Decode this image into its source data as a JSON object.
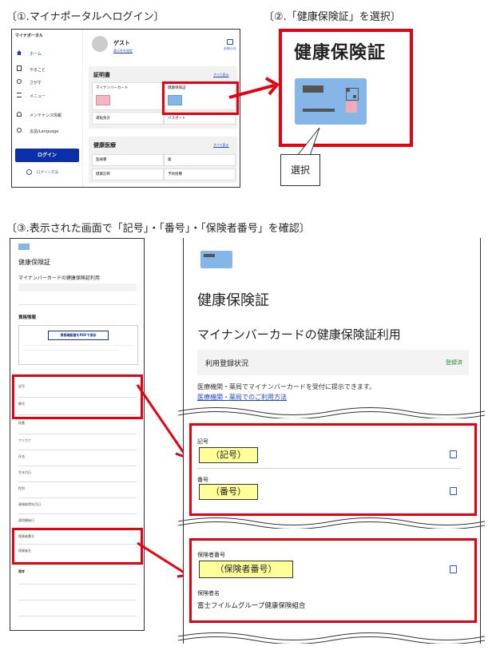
{
  "steps": {
    "step1": "〔①.マイナポータルへログイン〕",
    "step2": "〔②.「健康保険証」を選択〕",
    "step3": "〔③.表示された画面で「記号」・「番号」・「保険者番号」を確認〕"
  },
  "portal": {
    "brand": "マイナポータル",
    "nav": [
      "ホーム",
      "やること",
      "さがす",
      "メニュー",
      "メンテナンス情報",
      "言語/Language"
    ],
    "login_button": "ログイン",
    "login_howto": "ログイン方法",
    "user_name": "ゲスト",
    "user_link": "表示名を設定",
    "notification": "お知らせ",
    "section_certificates": "証明書",
    "section_health": "健康医療",
    "see_all": "すべて見る",
    "certificate_cards": [
      "マイナンバーカード",
      "健康保険証",
      "運転免許",
      "パスポート"
    ],
    "health_cards": [
      "医療費",
      "薬",
      "健康診断",
      "予防接種"
    ]
  },
  "zoom": {
    "title": "健康保険証",
    "callout": "選択"
  },
  "detail": {
    "page_title": "健康保険証",
    "subtitle": "マイナンバーカードの健康保険証利用",
    "registration_label": "利用登録状況",
    "registration_status": "登録済",
    "usage_note": "医療機関・薬局でマイナンバーカードを受付に提示できます。",
    "usage_link": "医療機関・薬局でのご利用方法",
    "kigo_label": "記号",
    "kigo_value": "（記号）",
    "bango_label": "番号",
    "bango_value": "（番号）",
    "insurer_no_label": "保険者番号",
    "insurer_no_value": "（保険者番号）",
    "insurer_name_label": "保険者名",
    "insurer_name_value": "富士フイルムグループ健康保険組合"
  },
  "left_detail": {
    "title": "健康保険証",
    "subtitle": "マイナンバーカードの健康保険証利用",
    "section": "資格情報",
    "pdf_button": "資格確認書をPDFで保存",
    "fields": [
      "記号",
      "番号",
      "枝番",
      "フリガナ",
      "氏名",
      "生年月日",
      "性別",
      "保険者番号",
      "保険者名",
      "資格取得年月日",
      "適用開始日",
      "備考"
    ]
  },
  "colors": {
    "accent_red": "#e60012",
    "card_blue": "#86b5e8",
    "login_blue": "#0b2fa8",
    "highlight_yellow": "#ffff99"
  }
}
